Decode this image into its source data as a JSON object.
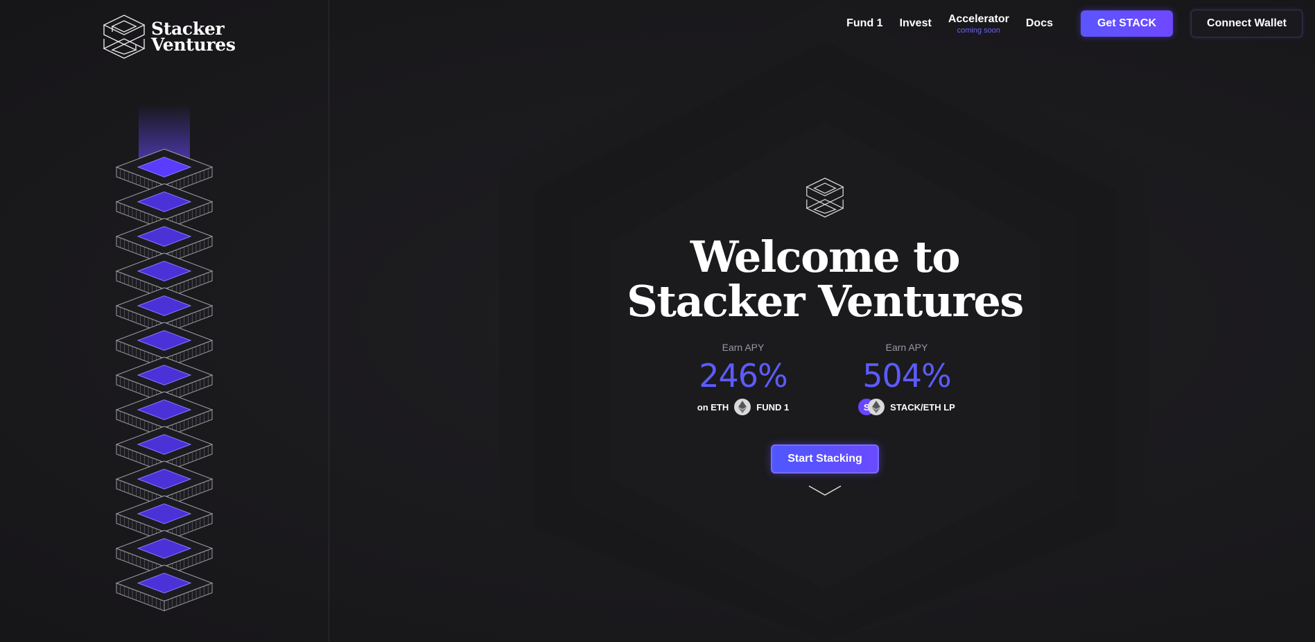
{
  "brand": {
    "line1": "Stacker",
    "line2": "Ventures",
    "logo_icon": "stacker-s-cube-icon"
  },
  "nav": {
    "links": [
      {
        "label": "Fund 1"
      },
      {
        "label": "Invest"
      },
      {
        "label": "Accelerator",
        "sub": "coming soon"
      },
      {
        "label": "Docs"
      }
    ],
    "get_stack": "Get STACK",
    "connect_wallet": "Connect Wallet"
  },
  "hero": {
    "title_line1": "Welcome to",
    "title_line2": "Stacker Ventures",
    "stats": [
      {
        "label": "Earn APY",
        "value": "246%",
        "prefix": "on ETH",
        "asset": "FUND 1",
        "icon": "eth-icon"
      },
      {
        "label": "Earn APY",
        "value": "504%",
        "asset": "STACK/ETH LP",
        "icon": "stack-eth-pair-icon"
      }
    ],
    "cta": "Start Stacking"
  },
  "colors": {
    "accent": "#5c5cff",
    "button": "#5b55ff",
    "background": "#1b1a1d"
  }
}
